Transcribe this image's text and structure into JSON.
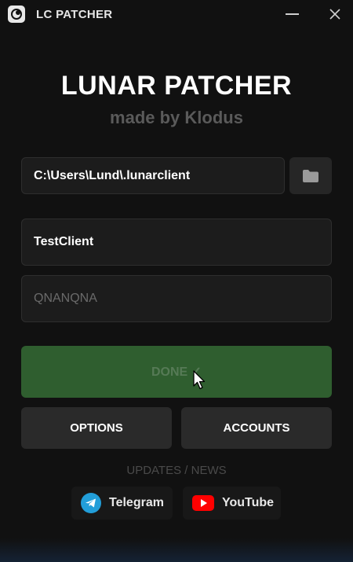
{
  "window": {
    "title": "LC PATCHER",
    "minimize_icon": "minimize-icon",
    "close_icon": "close-icon"
  },
  "header": {
    "title": "LUNAR PATCHER",
    "subtitle": "made by Klodus"
  },
  "form": {
    "path_value": "C:\\Users\\Lund\\.lunarclient",
    "folder_icon": "folder-icon",
    "client_name_value": "TestClient",
    "second_field_placeholder": "QNANQNA"
  },
  "actions": {
    "done_label": "DONE ✓",
    "options_label": "OPTIONS",
    "accounts_label": "ACCOUNTS"
  },
  "footer": {
    "section_label": "UPDATES / NEWS",
    "links": [
      {
        "label": "Telegram",
        "icon": "telegram-icon",
        "color": "#229ED9"
      },
      {
        "label": "YouTube",
        "icon": "youtube-icon",
        "color": "#FF0000"
      }
    ]
  },
  "colors": {
    "background": "#111111",
    "done_green": "#2f5e2f",
    "button_gray": "#2a2a2a"
  }
}
